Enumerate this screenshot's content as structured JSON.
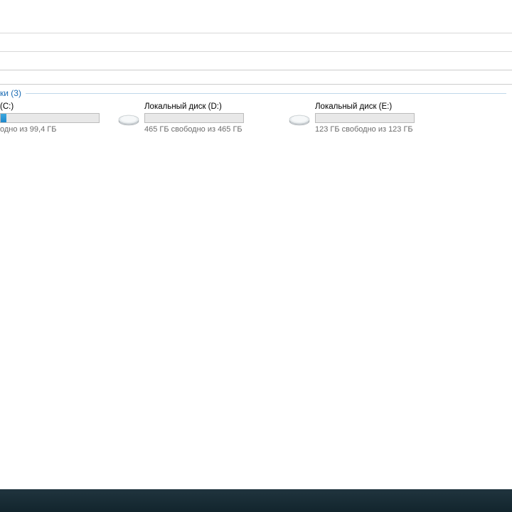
{
  "section": {
    "label": "ки (3)"
  },
  "drives": [
    {
      "name": " (C:)",
      "sub": "одно из 99,4 ГБ",
      "fill_percent": 6
    },
    {
      "name": "Локальный диск (D:)",
      "sub": "465 ГБ свободно из 465 ГБ",
      "fill_percent": 0
    },
    {
      "name": "Локальный диск (E:)",
      "sub": "123 ГБ свободно из 123 ГБ",
      "fill_percent": 0
    }
  ]
}
